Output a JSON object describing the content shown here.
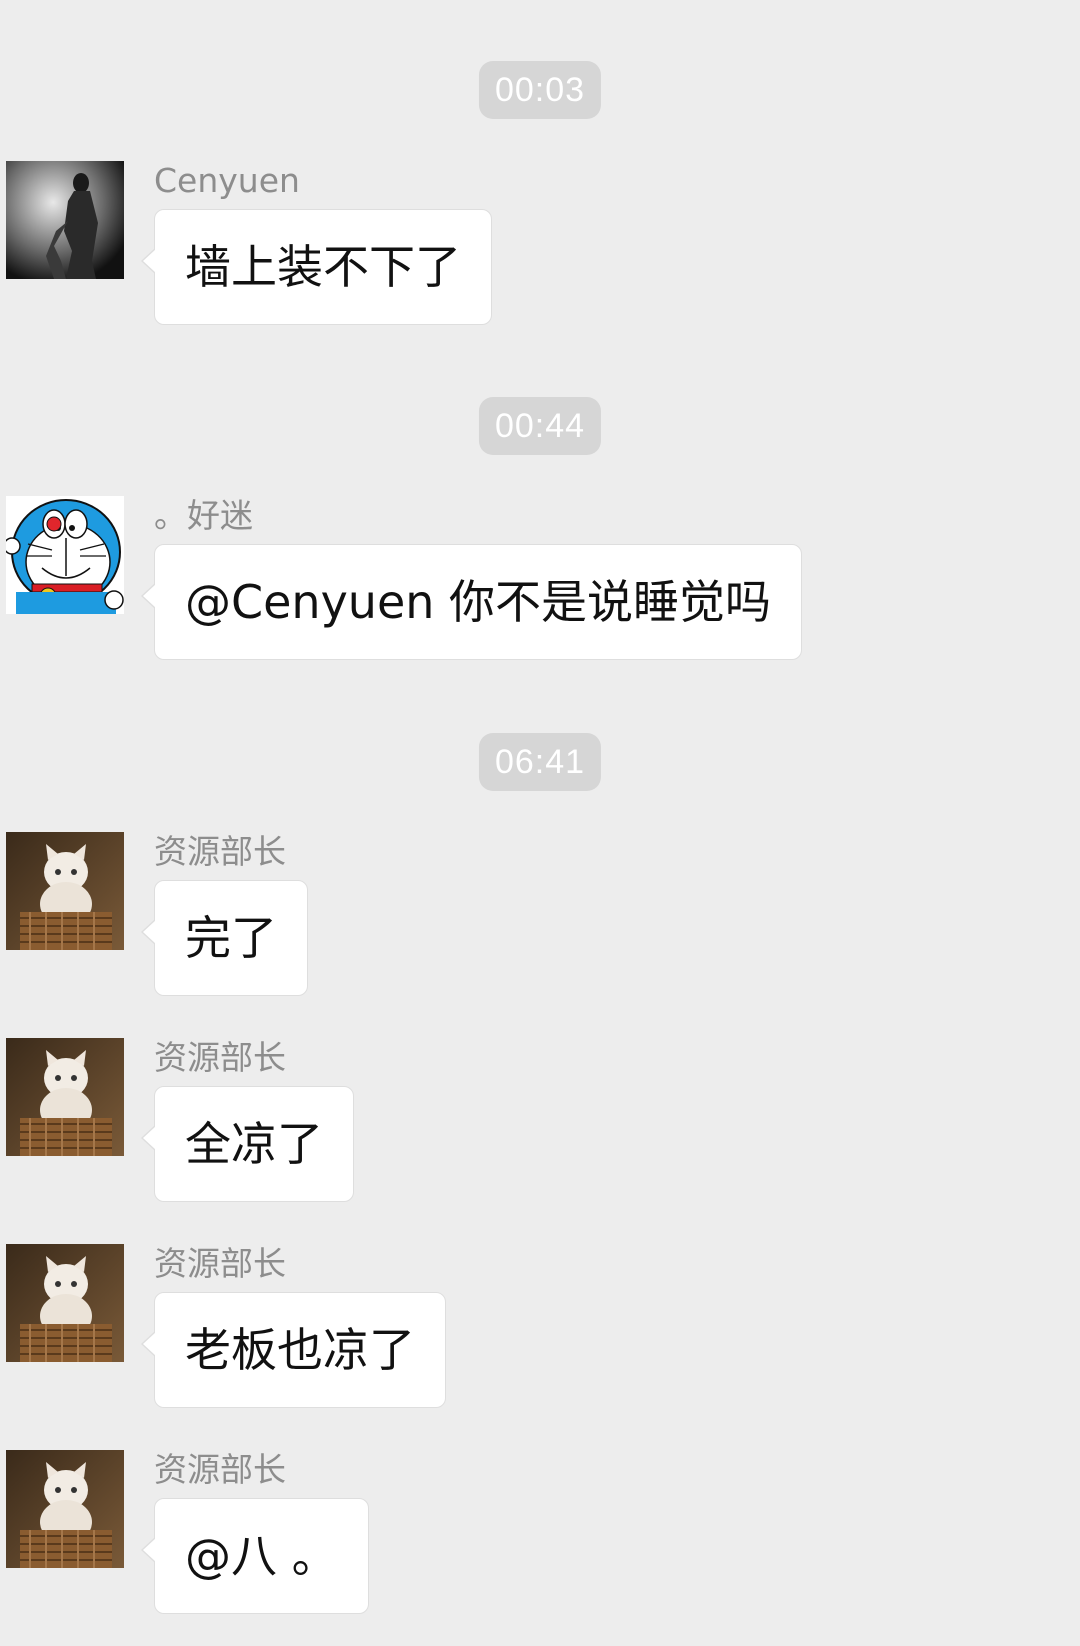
{
  "timestamps": [
    "00:03",
    "00:44",
    "06:41"
  ],
  "messages": [
    {
      "sender": "Cenyuen",
      "text": "墙上装不下了",
      "avatar": "person-photo-avatar"
    },
    {
      "sender": "。好迷",
      "text": "@Cenyuen 你不是说睡觉吗",
      "avatar": "doraemon-avatar"
    },
    {
      "sender": "资源部长",
      "text": "完了",
      "avatar": "kitten-basket-avatar"
    },
    {
      "sender": "资源部长",
      "text": "全凉了",
      "avatar": "kitten-basket-avatar"
    },
    {
      "sender": "资源部长",
      "text": "老板也凉了",
      "avatar": "kitten-basket-avatar"
    },
    {
      "sender": "资源部长",
      "text": "@八 。",
      "avatar": "kitten-basket-avatar"
    }
  ],
  "colors": {
    "background": "#ededed",
    "bubble": "#ffffff",
    "timestamp_bg": "#d6d6d6",
    "sender_text": "#8d8d8d"
  }
}
